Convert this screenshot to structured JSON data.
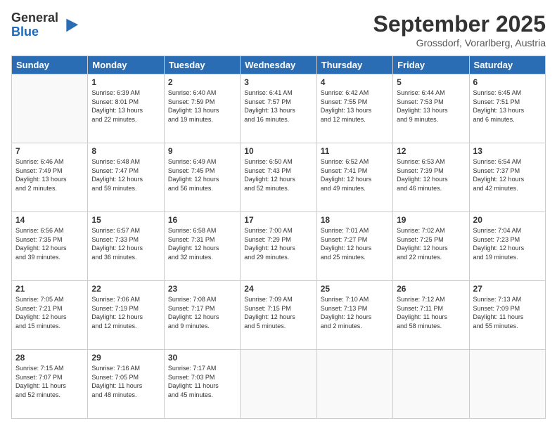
{
  "logo": {
    "general": "General",
    "blue": "Blue"
  },
  "title": "September 2025",
  "location": "Grossdorf, Vorarlberg, Austria",
  "headers": [
    "Sunday",
    "Monday",
    "Tuesday",
    "Wednesday",
    "Thursday",
    "Friday",
    "Saturday"
  ],
  "weeks": [
    [
      {
        "day": "",
        "detail": ""
      },
      {
        "day": "1",
        "detail": "Sunrise: 6:39 AM\nSunset: 8:01 PM\nDaylight: 13 hours\nand 22 minutes."
      },
      {
        "day": "2",
        "detail": "Sunrise: 6:40 AM\nSunset: 7:59 PM\nDaylight: 13 hours\nand 19 minutes."
      },
      {
        "day": "3",
        "detail": "Sunrise: 6:41 AM\nSunset: 7:57 PM\nDaylight: 13 hours\nand 16 minutes."
      },
      {
        "day": "4",
        "detail": "Sunrise: 6:42 AM\nSunset: 7:55 PM\nDaylight: 13 hours\nand 12 minutes."
      },
      {
        "day": "5",
        "detail": "Sunrise: 6:44 AM\nSunset: 7:53 PM\nDaylight: 13 hours\nand 9 minutes."
      },
      {
        "day": "6",
        "detail": "Sunrise: 6:45 AM\nSunset: 7:51 PM\nDaylight: 13 hours\nand 6 minutes."
      }
    ],
    [
      {
        "day": "7",
        "detail": "Sunrise: 6:46 AM\nSunset: 7:49 PM\nDaylight: 13 hours\nand 2 minutes."
      },
      {
        "day": "8",
        "detail": "Sunrise: 6:48 AM\nSunset: 7:47 PM\nDaylight: 12 hours\nand 59 minutes."
      },
      {
        "day": "9",
        "detail": "Sunrise: 6:49 AM\nSunset: 7:45 PM\nDaylight: 12 hours\nand 56 minutes."
      },
      {
        "day": "10",
        "detail": "Sunrise: 6:50 AM\nSunset: 7:43 PM\nDaylight: 12 hours\nand 52 minutes."
      },
      {
        "day": "11",
        "detail": "Sunrise: 6:52 AM\nSunset: 7:41 PM\nDaylight: 12 hours\nand 49 minutes."
      },
      {
        "day": "12",
        "detail": "Sunrise: 6:53 AM\nSunset: 7:39 PM\nDaylight: 12 hours\nand 46 minutes."
      },
      {
        "day": "13",
        "detail": "Sunrise: 6:54 AM\nSunset: 7:37 PM\nDaylight: 12 hours\nand 42 minutes."
      }
    ],
    [
      {
        "day": "14",
        "detail": "Sunrise: 6:56 AM\nSunset: 7:35 PM\nDaylight: 12 hours\nand 39 minutes."
      },
      {
        "day": "15",
        "detail": "Sunrise: 6:57 AM\nSunset: 7:33 PM\nDaylight: 12 hours\nand 36 minutes."
      },
      {
        "day": "16",
        "detail": "Sunrise: 6:58 AM\nSunset: 7:31 PM\nDaylight: 12 hours\nand 32 minutes."
      },
      {
        "day": "17",
        "detail": "Sunrise: 7:00 AM\nSunset: 7:29 PM\nDaylight: 12 hours\nand 29 minutes."
      },
      {
        "day": "18",
        "detail": "Sunrise: 7:01 AM\nSunset: 7:27 PM\nDaylight: 12 hours\nand 25 minutes."
      },
      {
        "day": "19",
        "detail": "Sunrise: 7:02 AM\nSunset: 7:25 PM\nDaylight: 12 hours\nand 22 minutes."
      },
      {
        "day": "20",
        "detail": "Sunrise: 7:04 AM\nSunset: 7:23 PM\nDaylight: 12 hours\nand 19 minutes."
      }
    ],
    [
      {
        "day": "21",
        "detail": "Sunrise: 7:05 AM\nSunset: 7:21 PM\nDaylight: 12 hours\nand 15 minutes."
      },
      {
        "day": "22",
        "detail": "Sunrise: 7:06 AM\nSunset: 7:19 PM\nDaylight: 12 hours\nand 12 minutes."
      },
      {
        "day": "23",
        "detail": "Sunrise: 7:08 AM\nSunset: 7:17 PM\nDaylight: 12 hours\nand 9 minutes."
      },
      {
        "day": "24",
        "detail": "Sunrise: 7:09 AM\nSunset: 7:15 PM\nDaylight: 12 hours\nand 5 minutes."
      },
      {
        "day": "25",
        "detail": "Sunrise: 7:10 AM\nSunset: 7:13 PM\nDaylight: 12 hours\nand 2 minutes."
      },
      {
        "day": "26",
        "detail": "Sunrise: 7:12 AM\nSunset: 7:11 PM\nDaylight: 11 hours\nand 58 minutes."
      },
      {
        "day": "27",
        "detail": "Sunrise: 7:13 AM\nSunset: 7:09 PM\nDaylight: 11 hours\nand 55 minutes."
      }
    ],
    [
      {
        "day": "28",
        "detail": "Sunrise: 7:15 AM\nSunset: 7:07 PM\nDaylight: 11 hours\nand 52 minutes."
      },
      {
        "day": "29",
        "detail": "Sunrise: 7:16 AM\nSunset: 7:05 PM\nDaylight: 11 hours\nand 48 minutes."
      },
      {
        "day": "30",
        "detail": "Sunrise: 7:17 AM\nSunset: 7:03 PM\nDaylight: 11 hours\nand 45 minutes."
      },
      {
        "day": "",
        "detail": ""
      },
      {
        "day": "",
        "detail": ""
      },
      {
        "day": "",
        "detail": ""
      },
      {
        "day": "",
        "detail": ""
      }
    ]
  ]
}
